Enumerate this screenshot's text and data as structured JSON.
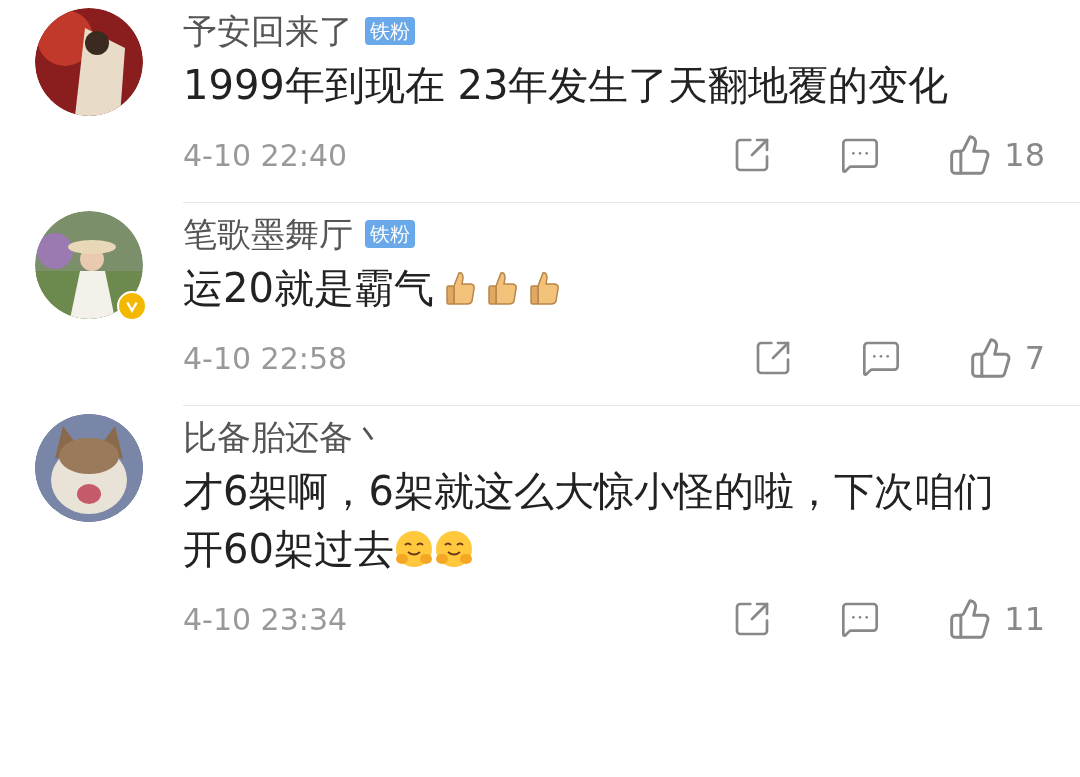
{
  "comments": [
    {
      "user": "予安回来了",
      "badge": "铁粉",
      "verified": false,
      "lines": [
        "1999年到现在 23年发生了天翻地覆的变化"
      ],
      "time": "4-10 22:40",
      "likes": "18"
    },
    {
      "user": "笔歌墨舞厅",
      "badge": "铁粉",
      "verified": true,
      "lines": [
        "运20就是霸气"
      ],
      "emojis": [
        {
          "kind": "thumbs-up"
        },
        {
          "kind": "thumbs-up"
        },
        {
          "kind": "thumbs-up"
        }
      ],
      "time": "4-10 22:58",
      "likes": "7"
    },
    {
      "user": "比备胎还备丶",
      "verified": false,
      "lines": [
        "才6架啊，6架就这么大惊小怪的啦，下次咱们",
        "开60架过去"
      ],
      "emojis": [
        {
          "kind": "hug"
        },
        {
          "kind": "hug"
        }
      ],
      "time": "4-10 23:34",
      "likes": "11"
    }
  ]
}
